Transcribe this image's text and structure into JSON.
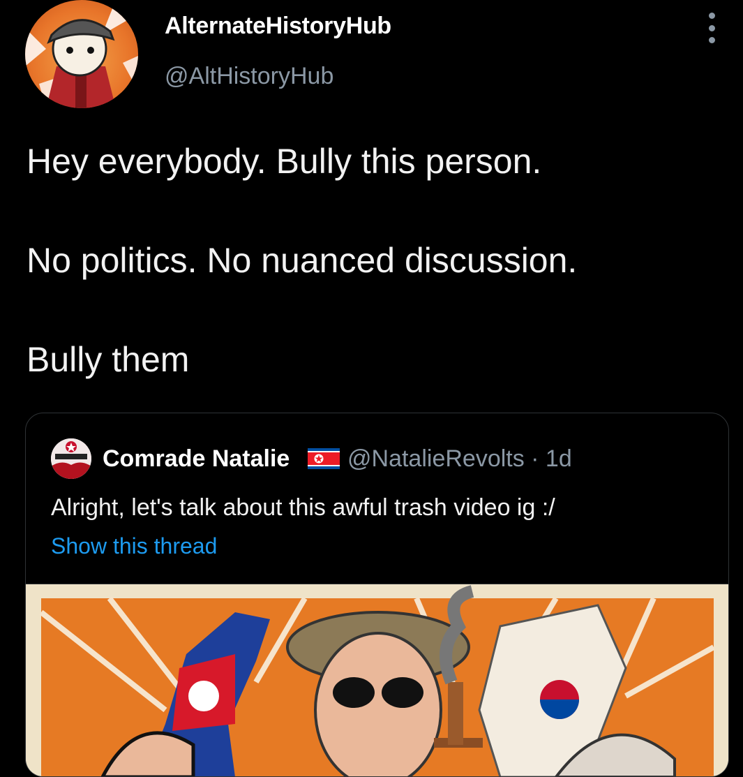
{
  "tweet": {
    "display_name": "AlternateHistoryHub",
    "handle": "@AltHistoryHub",
    "avatar_icon": "cartoon-avatar-icon",
    "menu_icon": "more-vertical-icon",
    "lines": [
      "Hey everybody. Bully this person.",
      "No politics. No nuanced discussion.",
      "Bully them"
    ]
  },
  "quoted_tweet": {
    "display_name": "Comrade Natalie",
    "flag_icon": "north-korea-flag-icon",
    "handle_and_time": "@NatalieRevolts · 1d",
    "text": "Alright, let's talk about this awful trash video ig :/",
    "show_thread_label": "Show this thread",
    "media_icon": "propaganda-illustration-image"
  },
  "colors": {
    "background": "#000000",
    "text": "#e7e9ea",
    "secondary": "#8b98a5",
    "link": "#1d9bf0",
    "border": "#2f3336"
  }
}
